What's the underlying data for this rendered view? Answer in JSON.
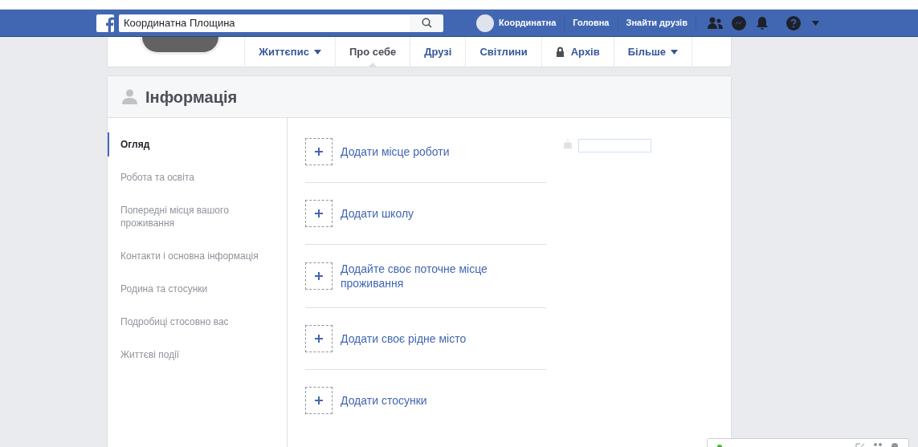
{
  "top_bar": {
    "search": {
      "value": "Координатна Площина"
    },
    "profile_name": "Координатна",
    "links": [
      "Головна",
      "Знайти друзів"
    ]
  },
  "profile_tabs": [
    {
      "label": "Життєпис",
      "kind": "dropdown",
      "selected": false
    },
    {
      "label": "Про себе",
      "kind": "plain",
      "selected": true
    },
    {
      "label": "Друзі",
      "kind": "plain",
      "selected": false
    },
    {
      "label": "Світлини",
      "kind": "plain",
      "selected": false
    },
    {
      "label": "Архів",
      "kind": "locked",
      "selected": false
    },
    {
      "label": "Більше",
      "kind": "dropdown",
      "selected": false
    }
  ],
  "info": {
    "title": "Інформація",
    "sidebar": [
      {
        "label": "Огляд",
        "selected": true
      },
      {
        "label": "Робота та освіта",
        "selected": false
      },
      {
        "label": "Попередні місця вашого проживання",
        "selected": false
      },
      {
        "label": "Контакти і основна інформація",
        "selected": false
      },
      {
        "label": "Родина та стосунки",
        "selected": false
      },
      {
        "label": "Подробиці стосовно вас",
        "selected": false
      },
      {
        "label": "Життєві події",
        "selected": false
      }
    ],
    "add_items": [
      "Додати місце роботи",
      "Додати школу",
      "Додайте своє поточне місце проживання",
      "Додати своє рідне місто",
      "Додати стосунки"
    ]
  }
}
